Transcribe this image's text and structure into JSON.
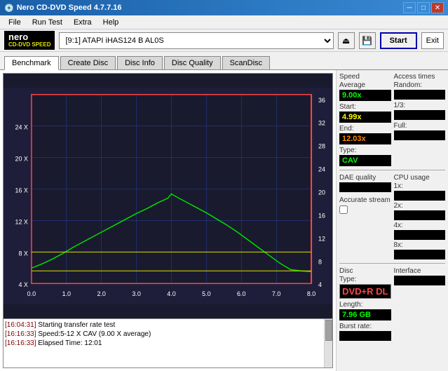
{
  "app": {
    "title": "Nero CD-DVD Speed 4.7.7.16",
    "icon": "●"
  },
  "titlebar": {
    "minimize": "─",
    "maximize": "□",
    "close": "✕"
  },
  "menu": {
    "items": [
      "File",
      "Run Test",
      "Extra",
      "Help"
    ]
  },
  "toolbar": {
    "drive_label": "[9:1]  ATAPI iHAS124  B AL0S",
    "start_label": "Start",
    "exit_label": "Exit"
  },
  "tabs": [
    {
      "id": "benchmark",
      "label": "Benchmark"
    },
    {
      "id": "create-disc",
      "label": "Create Disc"
    },
    {
      "id": "disc-info",
      "label": "Disc Info"
    },
    {
      "id": "disc-quality",
      "label": "Disc Quality"
    },
    {
      "id": "scan-disc",
      "label": "ScanDisc"
    }
  ],
  "active_tab": "benchmark",
  "chart": {
    "x_labels": [
      "0.0",
      "1.0",
      "2.0",
      "3.0",
      "4.0",
      "5.0",
      "6.0",
      "7.0",
      "8.0"
    ],
    "y_left_labels": [
      "4 X",
      "8 X",
      "12 X",
      "16 X",
      "20 X",
      "24 X"
    ],
    "y_right_labels": [
      "4",
      "8",
      "12",
      "16",
      "20",
      "24",
      "28",
      "32",
      "36"
    ]
  },
  "stats": {
    "speed": {
      "label": "Speed",
      "average_label": "Average",
      "average_value": "9.00x",
      "start_label": "Start:",
      "start_value": "4.99x",
      "end_label": "End:",
      "end_value": "12.03x",
      "type_label": "Type:",
      "type_value": "CAV"
    },
    "access_times": {
      "label": "Access times",
      "random_label": "Random:",
      "random_value": "",
      "onethird_label": "1/3:",
      "onethird_value": "",
      "full_label": "Full:",
      "full_value": ""
    },
    "cpu_usage": {
      "label": "CPU usage",
      "1x_label": "1x:",
      "1x_value": "",
      "2x_label": "2x:",
      "2x_value": "",
      "4x_label": "4x:",
      "4x_value": "",
      "8x_label": "8x:",
      "8x_value": ""
    },
    "dae_quality": {
      "label": "DAE quality",
      "value": ""
    },
    "accurate_stream": {
      "label": "Accurate stream"
    },
    "disc": {
      "type_label": "Disc",
      "type_sub_label": "Type:",
      "type_value": "DVD+R DL",
      "length_label": "Length:",
      "length_value": "7.96 GB",
      "burst_rate_label": "Burst rate:",
      "burst_rate_value": ""
    },
    "interface": {
      "label": "Interface",
      "value": ""
    }
  },
  "log": {
    "entries": [
      {
        "timestamp": "[16:04:31]",
        "message": "Starting transfer rate test"
      },
      {
        "timestamp": "[16:16:33]",
        "message": "Speed:5-12 X CAV (9.00 X average)"
      },
      {
        "timestamp": "[16:16:33]",
        "message": "Elapsed Time: 12:01"
      }
    ]
  }
}
